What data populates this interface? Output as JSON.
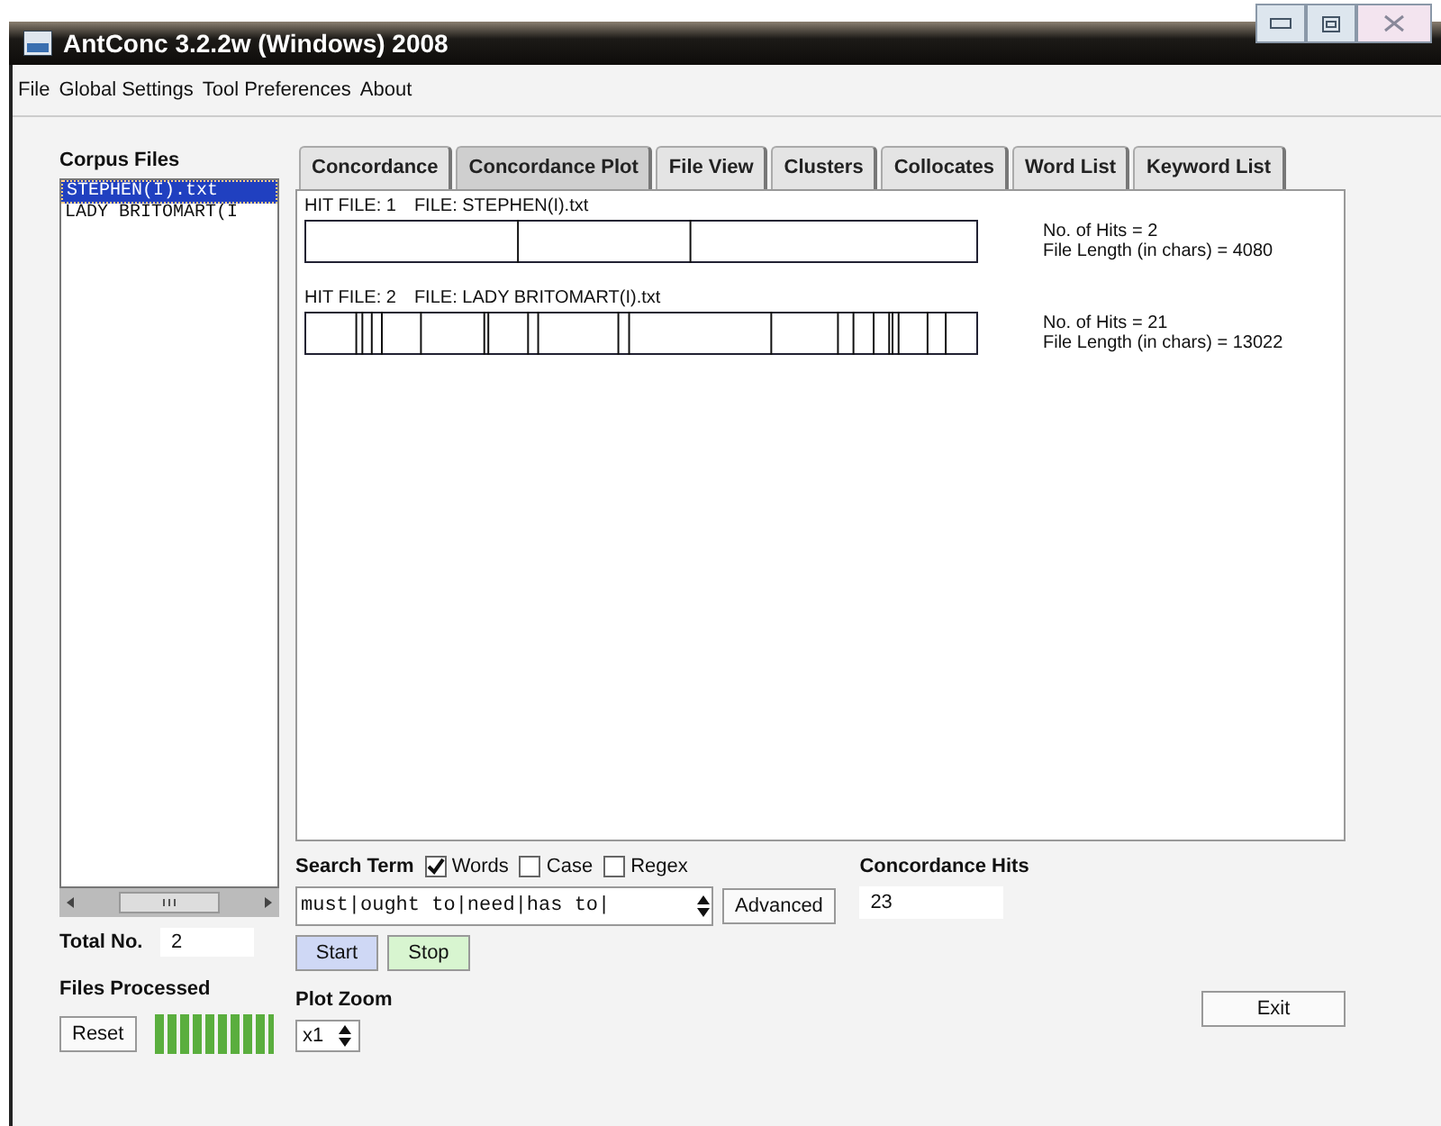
{
  "window": {
    "title": "AntConc 3.2.2w (Windows) 2008"
  },
  "menu": [
    "File",
    "Global Settings",
    "Tool Preferences",
    "About"
  ],
  "corpus_files": {
    "label": "Corpus Files",
    "items": [
      {
        "name": "STEPHEN(I).txt",
        "selected": true
      },
      {
        "name": "LADY BRITOMART(I",
        "selected": false
      }
    ]
  },
  "total": {
    "label": "Total No.",
    "value": "2"
  },
  "files_processed": {
    "label": "Files Processed",
    "button": "Reset",
    "level": 1
  },
  "tabs": [
    {
      "label": "Concordance",
      "selected": false
    },
    {
      "label": "Concordance Plot",
      "selected": true
    },
    {
      "label": "File View",
      "selected": false
    },
    {
      "label": "Clusters",
      "selected": false
    },
    {
      "label": "Collocates",
      "selected": false
    },
    {
      "label": "Word List",
      "selected": false
    },
    {
      "label": "Keyword List",
      "selected": false
    }
  ],
  "plots": [
    {
      "hit_file": "HIT FILE: 1",
      "file": "FILE: STEPHEN(I).txt",
      "hits": "No. of Hits = 2",
      "length": "File Length (in chars) = 4080"
    },
    {
      "hit_file": "HIT FILE: 2",
      "file": "FILE: LADY BRITOMART(I).txt",
      "hits": "No. of Hits = 21",
      "length": "File Length (in chars) = 13022"
    }
  ],
  "search": {
    "label": "Search Term",
    "options": [
      {
        "label": "Words",
        "checked": true
      },
      {
        "label": "Case",
        "checked": false
      },
      {
        "label": "Regex",
        "checked": false
      }
    ],
    "value": "must|ought to|need|has to|",
    "advanced": "Advanced",
    "start": "Start",
    "stop": "Stop"
  },
  "concordance_hits": {
    "label": "Concordance Hits",
    "value": "23"
  },
  "plot_zoom": {
    "label": "Plot Zoom",
    "value": "x1"
  },
  "exit": "Exit"
}
